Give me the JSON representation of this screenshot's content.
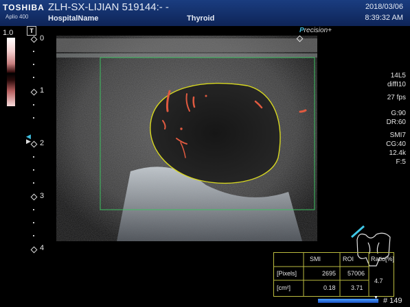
{
  "header": {
    "brand": "TOSHIBA",
    "model": "Aplio 400",
    "patient": "ZLH-SX-LIJIAN 519144:- -",
    "hospital": "HospitalName",
    "exam": "Thyroid",
    "date": "2018/03/06",
    "time": "8:39:32 AM"
  },
  "gain_label": "1.0",
  "t_badge": "T",
  "depth_labels": [
    "0",
    "1",
    "2",
    "3",
    "4"
  ],
  "precision": {
    "prefix": "P",
    "suffix": "recision",
    "plus": "+"
  },
  "params": [
    "14L5",
    "diffI10",
    "27 fps",
    "G:90",
    "DR:60",
    "SMI7",
    "CG:40",
    "12.4k",
    "F:5"
  ],
  "measurements": {
    "headers": [
      "SMI",
      "ROI",
      "Ratio[%]"
    ],
    "rows": [
      {
        "label": "[Pixels]",
        "smi": "2695",
        "roi": "57006"
      },
      {
        "label": "[cm²]",
        "smi": "0.18",
        "roi": "3.71"
      }
    ],
    "ratio": "4.7"
  },
  "frame_label": "# 149",
  "colors": {
    "roi": "#d8d820",
    "box": "#3cc060",
    "flow": "#e05a40",
    "header": "#12306a"
  }
}
